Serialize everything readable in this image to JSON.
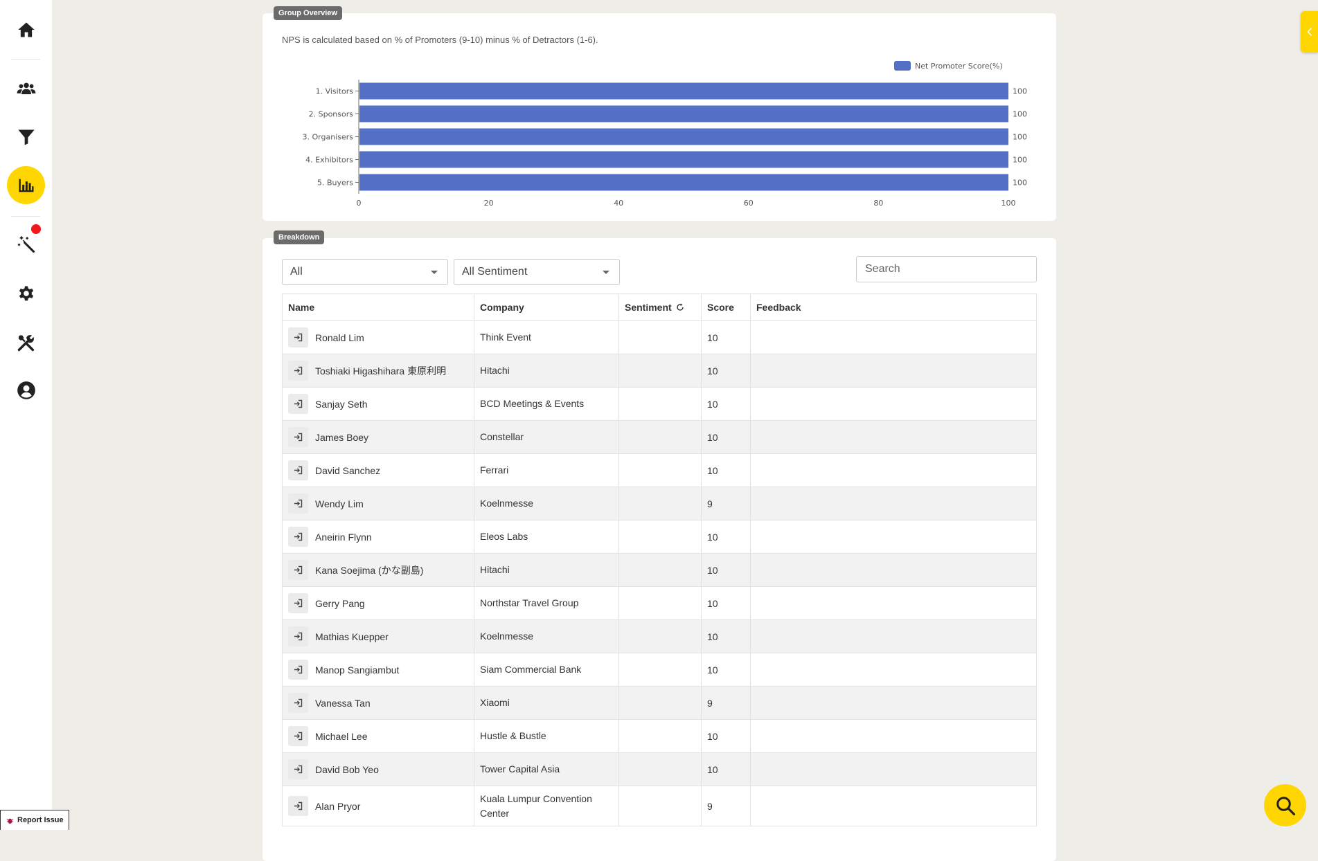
{
  "sidebar": {
    "items": [
      {
        "icon": "home-icon"
      },
      {
        "icon": "users-icon"
      },
      {
        "icon": "filter-icon"
      },
      {
        "icon": "bar-chart-icon",
        "active": true
      },
      {
        "icon": "magic-wand-icon",
        "notification": true
      },
      {
        "icon": "gear-icon"
      },
      {
        "icon": "tools-icon"
      },
      {
        "icon": "user-circle-icon"
      }
    ]
  },
  "report_issue": {
    "label": "Report Issue"
  },
  "group_overview": {
    "badge": "Group Overview",
    "note": "NPS is calculated based on % of Promoters (9-10) minus % of Detractors (1-6)."
  },
  "chart_data": {
    "type": "bar",
    "orientation": "horizontal",
    "categories": [
      "1. Visitors",
      "2. Sponsors",
      "3. Organisers",
      "4. Exhibitors",
      "5. Buyers"
    ],
    "series": [
      {
        "name": "Net Promoter Score(%)",
        "values": [
          100,
          100,
          100,
          100,
          100
        ],
        "color": "#5470c6"
      }
    ],
    "xlim": [
      0,
      100
    ],
    "xticks": [
      0,
      20,
      40,
      60,
      80,
      100
    ],
    "legend": "top-right",
    "grid": false
  },
  "breakdown": {
    "badge": "Breakdown",
    "filter_group": {
      "selected": "All"
    },
    "filter_sentiment": {
      "selected": "All Sentiment"
    },
    "search": {
      "placeholder": "Search",
      "value": ""
    },
    "columns": {
      "name": "Name",
      "company": "Company",
      "sentiment": "Sentiment",
      "score": "Score",
      "feedback": "Feedback"
    },
    "rows": [
      {
        "name": "Ronald Lim",
        "company": "Think Event",
        "sentiment": "",
        "score": "10",
        "feedback": ""
      },
      {
        "name": "Toshiaki Higashihara 東原利明",
        "company": "Hitachi",
        "sentiment": "",
        "score": "10",
        "feedback": ""
      },
      {
        "name": "Sanjay Seth",
        "company": "BCD Meetings & Events",
        "sentiment": "",
        "score": "10",
        "feedback": ""
      },
      {
        "name": "James Boey",
        "company": "Constellar",
        "sentiment": "",
        "score": "10",
        "feedback": ""
      },
      {
        "name": "David Sanchez",
        "company": "Ferrari",
        "sentiment": "",
        "score": "10",
        "feedback": ""
      },
      {
        "name": "Wendy Lim",
        "company": "Koelnmesse",
        "sentiment": "",
        "score": "9",
        "feedback": ""
      },
      {
        "name": "Aneirin Flynn",
        "company": "Eleos Labs",
        "sentiment": "",
        "score": "10",
        "feedback": ""
      },
      {
        "name": "Kana Soejima (かな副島)",
        "company": "Hitachi",
        "sentiment": "",
        "score": "10",
        "feedback": ""
      },
      {
        "name": "Gerry Pang",
        "company": "Northstar Travel Group",
        "sentiment": "",
        "score": "10",
        "feedback": ""
      },
      {
        "name": "Mathias Kuepper",
        "company": "Koelnmesse",
        "sentiment": "",
        "score": "10",
        "feedback": ""
      },
      {
        "name": "Manop Sangiambut",
        "company": "Siam Commercial Bank",
        "sentiment": "",
        "score": "10",
        "feedback": ""
      },
      {
        "name": "Vanessa Tan",
        "company": "Xiaomi",
        "sentiment": "",
        "score": "9",
        "feedback": ""
      },
      {
        "name": "Michael Lee",
        "company": "Hustle & Bustle",
        "sentiment": "",
        "score": "10",
        "feedback": ""
      },
      {
        "name": "David Bob Yeo",
        "company": "Tower Capital Asia",
        "sentiment": "",
        "score": "10",
        "feedback": ""
      },
      {
        "name": "Alan Pryor",
        "company": "Kuala Lumpur Convention Center",
        "sentiment": "",
        "score": "9",
        "feedback": ""
      }
    ]
  },
  "colors": {
    "accent": "#ffd600",
    "bar": "#5470c6",
    "badge": "#6b6b6b",
    "notification": "#f01818"
  }
}
